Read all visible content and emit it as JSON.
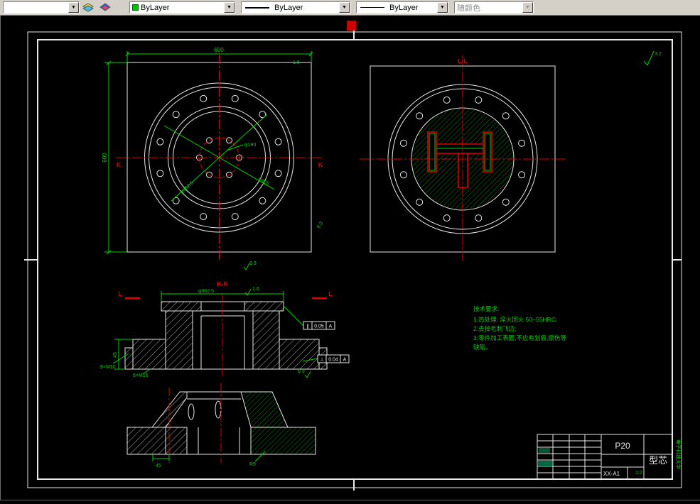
{
  "toolbar": {
    "combo1_value": "",
    "arrow": "▼",
    "color_combo": "ByLayer",
    "linetype_combo": "ByLayer",
    "lineweight_combo": "ByLayer",
    "plotstyle_combo": "随颜色"
  },
  "drawing": {
    "plan": {
      "width_dim": "600",
      "height_dim": "600",
      "bolt_circle_dim": "φ190",
      "diag_dim1": "φ465",
      "diag_dim2": "φ362.5",
      "section_letter_left": "K",
      "section_letter_right": "K",
      "rough1": "6.3",
      "rough2": "6.3",
      "rough3": "1.6"
    },
    "section_ll": {
      "label": "L-L"
    },
    "section_kk": {
      "label": "K-K",
      "top_dim": "φ362.5",
      "top_rough": "1.6",
      "left_dim": "45",
      "thread_note": "9×M30",
      "bottom_note": "6×M16",
      "l_left": "L",
      "l_right": "L",
      "rough_br": "6.3",
      "tol1_sym": "∥",
      "tol1_val": "0.05",
      "tol1_datum": "A",
      "tol2_sym": "⊥",
      "tol2_val": "0.04",
      "tol2_datum": "A"
    },
    "bottom_view": {
      "dim_45": "45",
      "dim_r9": "R9"
    },
    "corner_rough": "3.2",
    "tech_req": {
      "title": "技术要求:",
      "lines": [
        "1:热处理: 淬火回火 50~55HRC;",
        "2:去掉毛刺飞边;",
        "3:零件加工表面,不应有划痕,擦伤等",
        "缺陷。"
      ]
    },
    "title_block": {
      "material": "P20",
      "part_name": "型芯",
      "drawing_no": "XX-A1",
      "scale": "1:2",
      "school": "电子科技大学"
    }
  }
}
